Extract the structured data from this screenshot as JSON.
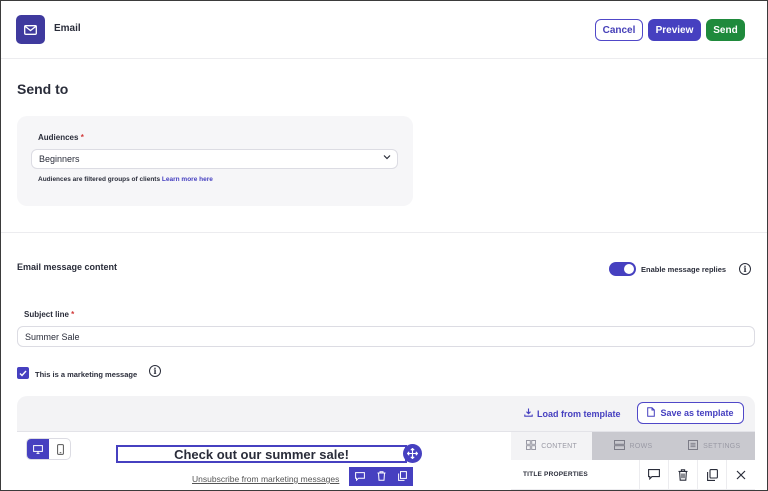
{
  "header": {
    "title": "Email",
    "cancel_label": "Cancel",
    "preview_label": "Preview",
    "send_label": "Send"
  },
  "send_to": {
    "title": "Send to",
    "audiences_label": "Audiences",
    "required_mark": "*",
    "selected_audience": "Beginners",
    "help_text": "Audiences are filtered groups of clients",
    "help_link": "Learn more here"
  },
  "content": {
    "title": "Email message content",
    "replies_toggle_label": "Enable message replies",
    "replies_enabled": true,
    "subject_label": "Subject line",
    "subject_value": "Summer Sale",
    "marketing_label": "This is a marketing message",
    "marketing_checked": true
  },
  "editor": {
    "load_template_label": "Load from template",
    "save_template_label": "Save as template",
    "headline_text": "Check out our summer sale!",
    "unsubscribe_text": "Unsubscribe from marketing messages",
    "panel_tabs": [
      {
        "label": "CONTENT",
        "icon": "grid-icon"
      },
      {
        "label": "ROWS",
        "icon": "rows-icon"
      },
      {
        "label": "SETTINGS",
        "icon": "settings-panel-icon"
      }
    ],
    "panel_row_title": "TITLE PROPERTIES"
  },
  "colors": {
    "brand": "#4640c0",
    "send": "#1f8a3c",
    "required": "#d23b3b"
  }
}
